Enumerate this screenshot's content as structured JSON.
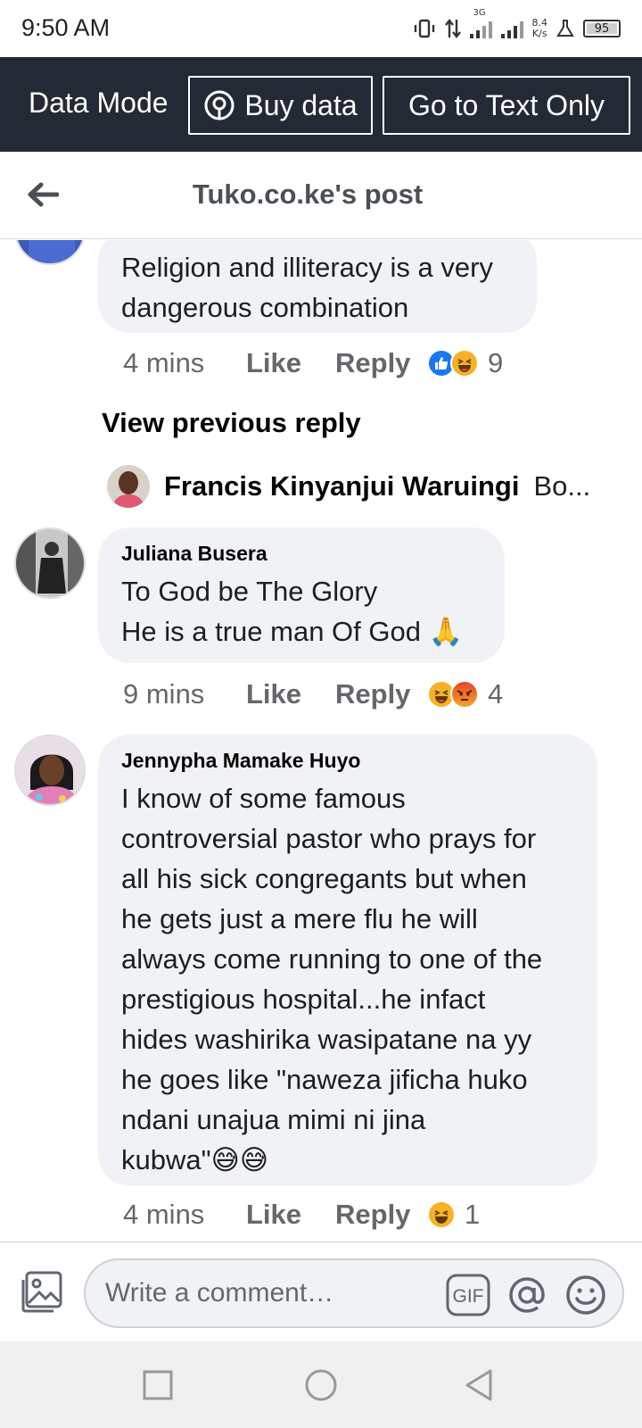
{
  "status_bar": {
    "time": "9:50 AM",
    "network_type": "3G",
    "speed_value": "8.4",
    "speed_unit": "K/s",
    "battery": "95"
  },
  "data_bar": {
    "mode_label": "Data Mode",
    "buy_data_label": "Buy data",
    "text_only_label": "Go to Text Only",
    "background_color": "#242a35"
  },
  "header": {
    "title": "Tuko.co.ke's post"
  },
  "comments": [
    {
      "author": "",
      "text": "Religion and illiteracy is a very\ndangerous combination",
      "time": "4 mins",
      "like_label": "Like",
      "reply_label": "Reply",
      "reactions": [
        "like-icon",
        "haha-icon"
      ],
      "reaction_count": "9"
    },
    {
      "author": "Juliana Busera",
      "text": "To God be The Glory\nHe is a true man Of God 🙏",
      "time": "9 mins",
      "like_label": "Like",
      "reply_label": "Reply",
      "reactions": [
        "haha-icon",
        "angry-icon"
      ],
      "reaction_count": "4"
    },
    {
      "author": "Jennypha Mamake Huyo",
      "text": "I know of some famous\ncontroversial pastor who prays for\nall his sick congregants but when\nhe gets just a mere flu he will\nalways come running to one of the\nprestigious hospital...he infact\nhides washirika wasipatane na yy\nhe goes like \"naweza jificha huko\nndani unajua mimi ni jina\nkubwa\"😅😅",
      "time": "4 mins",
      "like_label": "Like",
      "reply_label": "Reply",
      "reactions": [
        "haha-icon"
      ],
      "reaction_count": "1"
    }
  ],
  "view_previous_reply": "View previous reply",
  "reply_preview": {
    "name": "Francis Kinyanjui Waruingi",
    "snippet": "Bo..."
  },
  "composer": {
    "placeholder": "Write a comment…",
    "gif_label": "GIF"
  },
  "colors": {
    "bubble": "#f0f2f5",
    "like_blue": "#1877f2",
    "haha_yellow": "#f7b125",
    "angry_orange": "#e9710f"
  }
}
